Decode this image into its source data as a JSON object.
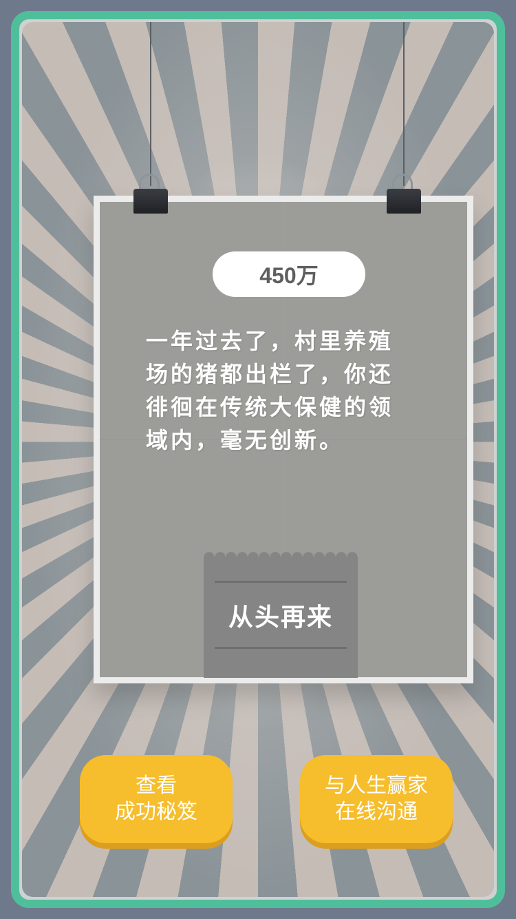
{
  "score": "450万",
  "story_lines": [
    "一年过去了，村里养殖",
    "场的猪都出栏了，你还",
    "徘徊在传统大保健的领",
    "域内，毫无创新。"
  ],
  "restart_label": "从头再来",
  "buttons": {
    "tips": {
      "line1": "查看",
      "line2": "成功秘笈"
    },
    "chat": {
      "line1": "与人生赢家",
      "line2": "在线沟通"
    }
  },
  "colors": {
    "frame_border": "#4fbf9b",
    "button_yellow": "#f6bd2c",
    "poster_gray": "#9c9d99"
  }
}
